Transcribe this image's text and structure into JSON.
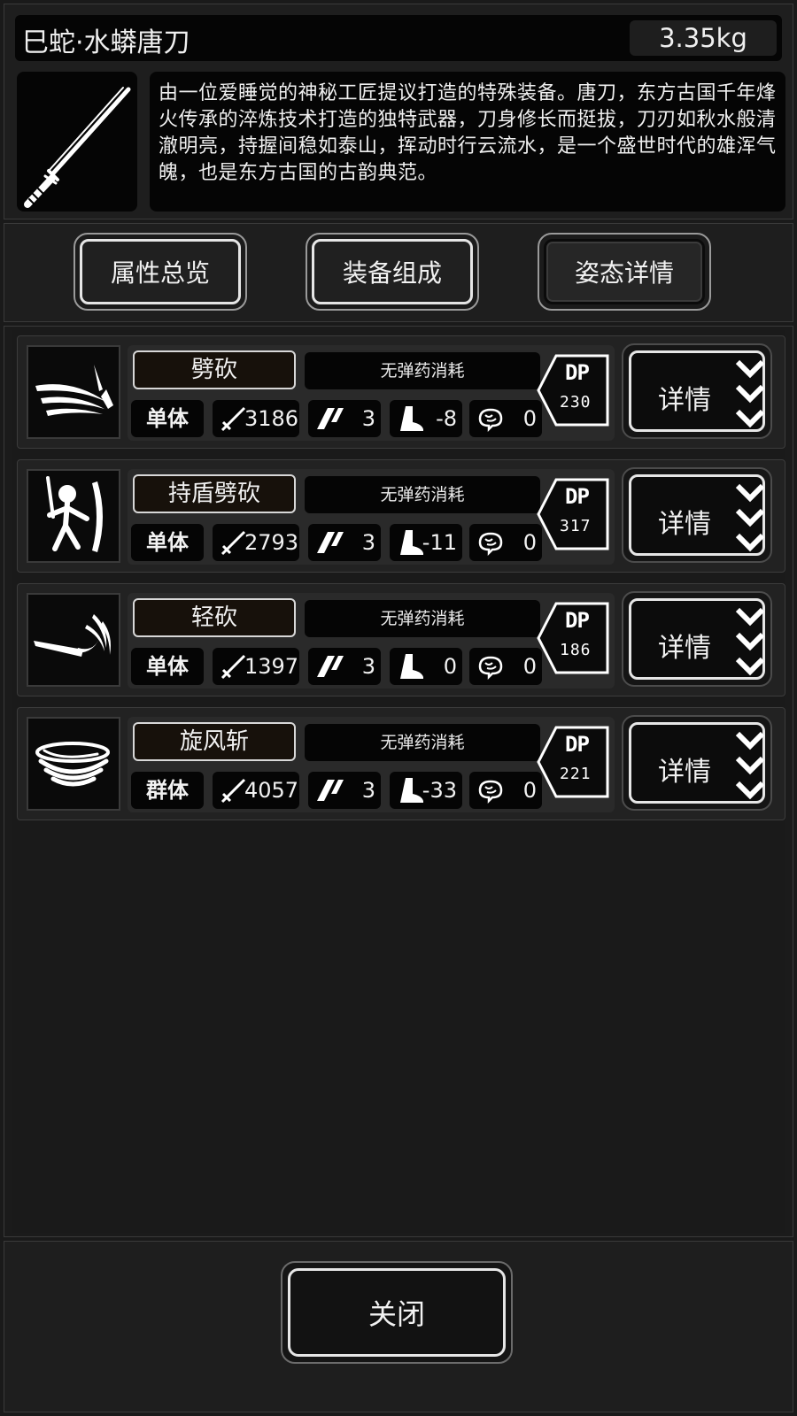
{
  "item": {
    "title": "巳蛇·水蟒唐刀",
    "weight": "3.35kg",
    "icon": "katana-icon",
    "description": "由一位爱睡觉的神秘工匠提议打造的特殊装备。唐刀，东方古国千年烽火传承的淬炼技术打造的独特武器，刀身修长而挺拔，刀刃如秋水般清澈明亮，持握间稳如泰山，挥动时行云流水，是一个盛世时代的雄浑气魄，也是东方古国的古韵典范。"
  },
  "tabs": [
    {
      "label": "属性总览",
      "active": false
    },
    {
      "label": "装备组成",
      "active": false
    },
    {
      "label": "姿态详情",
      "active": true
    }
  ],
  "skills": [
    {
      "icon": "slash-icon",
      "name": "劈砍",
      "ammo": "无弹药消耗",
      "target": "单体",
      "attack": "3186",
      "hits": "3",
      "move": "-8",
      "mind": "0",
      "dp_label": "DP",
      "dp": "230",
      "detail": "详情"
    },
    {
      "icon": "shield-slash-icon",
      "name": "持盾劈砍",
      "ammo": "无弹药消耗",
      "target": "单体",
      "attack": "2793",
      "hits": "3",
      "move": "-11",
      "mind": "0",
      "dp_label": "DP",
      "dp": "317",
      "detail": "详情"
    },
    {
      "icon": "light-slash-icon",
      "name": "轻砍",
      "ammo": "无弹药消耗",
      "target": "单体",
      "attack": "1397",
      "hits": "3",
      "move": "0",
      "mind": "0",
      "dp_label": "DP",
      "dp": "186",
      "detail": "详情"
    },
    {
      "icon": "whirlwind-icon",
      "name": "旋风斩",
      "ammo": "无弹药消耗",
      "target": "群体",
      "attack": "4057",
      "hits": "3",
      "move": "-33",
      "mind": "0",
      "dp_label": "DP",
      "dp": "221",
      "detail": "详情"
    }
  ],
  "footer": {
    "close_label": "关闭"
  }
}
